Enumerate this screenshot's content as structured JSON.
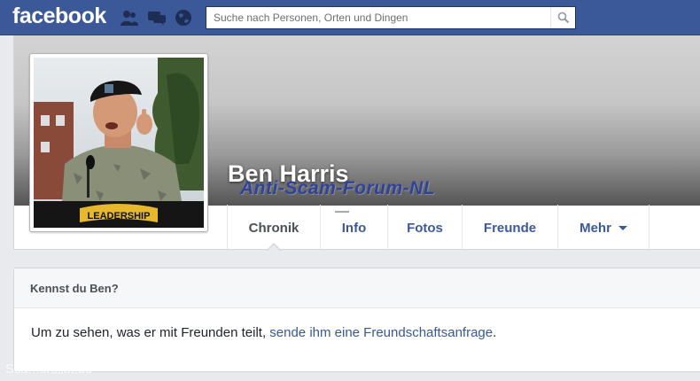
{
  "topbar": {
    "logo": "facebook",
    "jewels": [
      "friend-requests-icon",
      "messages-icon",
      "notifications-globe-icon"
    ],
    "search": {
      "placeholder": "Suche nach Personen, Orten und Dingen",
      "value": ""
    },
    "color": "#3b5998"
  },
  "profile": {
    "name": "Ben Harris",
    "picture_badge": "LEADERSHIP",
    "cover_overlay_watermark": "Anti-Scam-Forum-NL"
  },
  "tabs": [
    {
      "label": "Chronik",
      "active": true
    },
    {
      "label": "Info",
      "active": false
    },
    {
      "label": "Fotos",
      "active": false
    },
    {
      "label": "Freunde",
      "active": false
    },
    {
      "label": "Mehr",
      "active": false,
      "dropdown": true
    }
  ],
  "know_card": {
    "title": "Kennst du Ben?",
    "text": "Um zu sehen, was er mit Freunden teilt, ",
    "link": "sende ihm eine Freundschaftsanfrage",
    "suffix": "."
  },
  "site_watermark": "Scamerslist.de",
  "colors": {
    "link": "#365899",
    "page_bg": "#e9eaed",
    "text": "#1d2129"
  }
}
